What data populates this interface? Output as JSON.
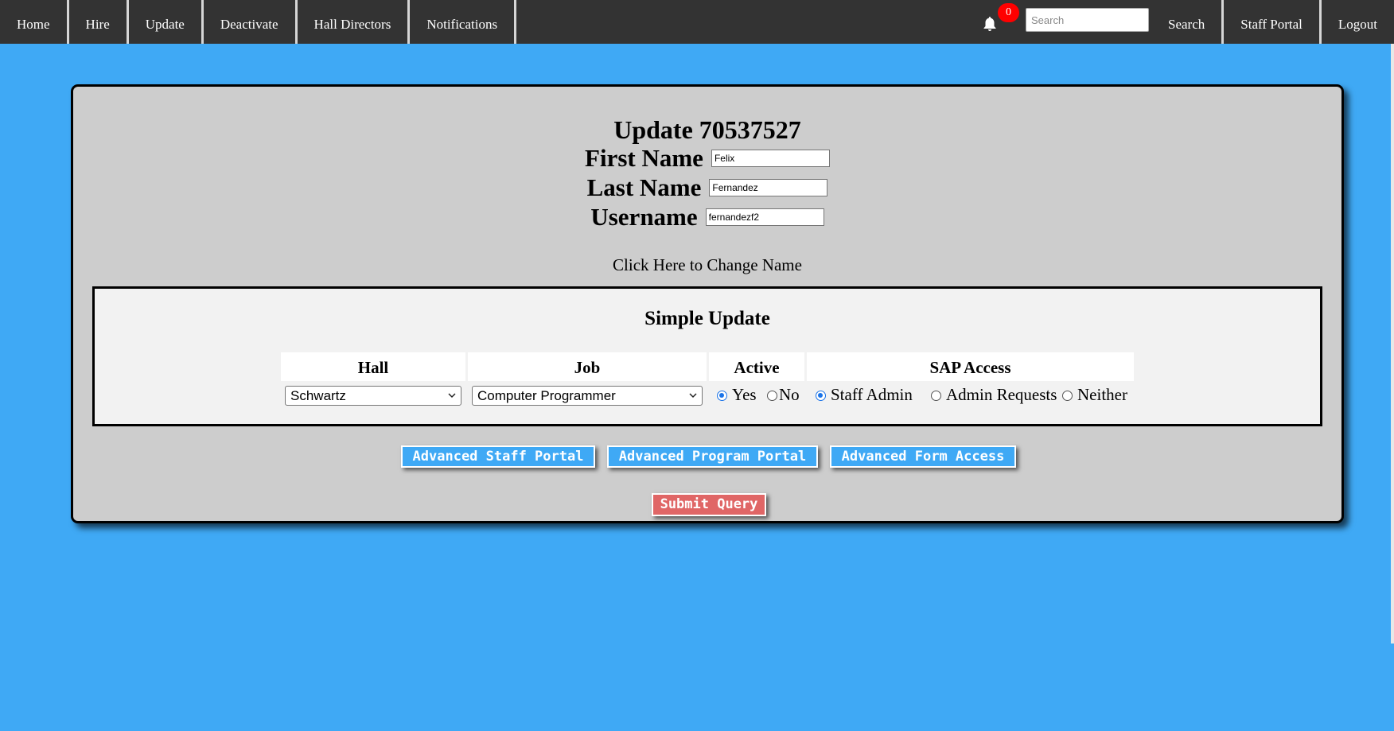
{
  "nav": {
    "left_items": [
      "Home",
      "Hire",
      "Update",
      "Deactivate",
      "Hall Directors",
      "Notifications"
    ],
    "notification_count": "0",
    "search_placeholder": "Search",
    "search_button": "Search",
    "staff_portal": "Staff Portal",
    "logout": "Logout"
  },
  "form": {
    "title": "Update 70537527",
    "first_name_label": "First Name",
    "first_name_value": "Felix",
    "last_name_label": "Last Name",
    "last_name_value": "Fernandez",
    "username_label": "Username",
    "username_value": "fernandezf2",
    "change_name_link": "Click Here to Change Name"
  },
  "simple_update": {
    "title": "Simple Update",
    "headers": {
      "hall": "Hall",
      "job": "Job",
      "active": "Active",
      "sap": "SAP Access"
    },
    "hall_selected": "Schwartz",
    "job_selected": "Computer Programmer",
    "active_options": [
      "Yes",
      "No"
    ],
    "active_selected": "Yes",
    "sap_options": [
      "Staff Admin",
      "Admin Requests",
      "Neither"
    ],
    "sap_selected": "Staff Admin"
  },
  "buttons": {
    "advanced_staff": "Advanced Staff Portal",
    "advanced_program": "Advanced Program Portal",
    "advanced_form": "Advanced Form Access",
    "submit": "Submit Query"
  },
  "colors": {
    "background": "#3fa9f5",
    "nav": "#333333",
    "card": "#cdcdcd",
    "badge": "#ff0000",
    "submit": "#e06666"
  }
}
